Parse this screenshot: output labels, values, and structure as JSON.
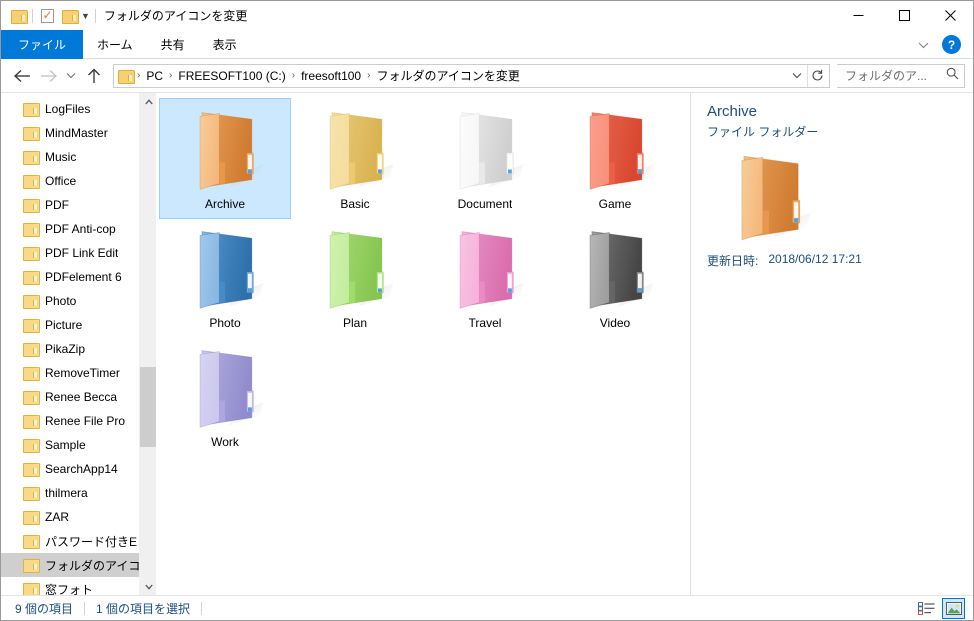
{
  "window": {
    "title": "フォルダのアイコンを変更",
    "quick_access": [
      "folder-icon",
      "properties-icon",
      "new-folder-icon",
      "dropdown-caret-icon"
    ],
    "controls": {
      "minimize": "─",
      "maximize": "□",
      "close": "✕"
    }
  },
  "ribbon": {
    "tabs": [
      {
        "label": "ファイル",
        "active_blue": true
      },
      {
        "label": "ホーム",
        "active_blue": false
      },
      {
        "label": "共有",
        "active_blue": false
      },
      {
        "label": "表示",
        "active_blue": false
      }
    ],
    "collapse_icon": "chevron-down-icon",
    "help_label": "?"
  },
  "nav": {
    "back_icon": "←",
    "forward_icon": "→",
    "recent_icon": "⌄",
    "up_icon": "↑",
    "breadcrumbs": [
      "PC",
      "FREESOFT100 (C:)",
      "freesoft100",
      "フォルダのアイコンを変更"
    ],
    "breadcrumb_separator": "›",
    "dropdown_icon": "⌄",
    "refresh_icon": "↻",
    "search": {
      "placeholder": "フォルダのア...",
      "value": "",
      "icon": "search-icon"
    }
  },
  "sidebar": {
    "items": [
      {
        "label": "LogFiles",
        "selected": false
      },
      {
        "label": "MindMaster",
        "selected": false
      },
      {
        "label": "Music",
        "selected": false
      },
      {
        "label": "Office",
        "selected": false
      },
      {
        "label": "PDF",
        "selected": false
      },
      {
        "label": "PDF Anti-cop",
        "selected": false
      },
      {
        "label": "PDF Link Edit",
        "selected": false
      },
      {
        "label": "PDFelement 6",
        "selected": false
      },
      {
        "label": "Photo",
        "selected": false
      },
      {
        "label": "Picture",
        "selected": false
      },
      {
        "label": "PikaZip",
        "selected": false
      },
      {
        "label": "RemoveTimer",
        "selected": false
      },
      {
        "label": "Renee Becca",
        "selected": false
      },
      {
        "label": "Renee File Pro",
        "selected": false
      },
      {
        "label": "Sample",
        "selected": false
      },
      {
        "label": "SearchApp14",
        "selected": false
      },
      {
        "label": "thilmera",
        "selected": false
      },
      {
        "label": "ZAR",
        "selected": false
      },
      {
        "label": "パスワード付きE",
        "selected": false
      },
      {
        "label": "フォルダのアイコ",
        "selected": true
      },
      {
        "label": "窓フォト",
        "selected": false
      }
    ],
    "scroll_up_icon": "⌃",
    "scroll_down_icon": "⌄"
  },
  "content": {
    "items": [
      {
        "label": "Archive",
        "selected": true,
        "colors": {
          "light": "#f7c383",
          "mid": "#ec9b4f",
          "dark": "#dd8335",
          "flap": "#f2a960",
          "edge": "#c97526"
        }
      },
      {
        "label": "Basic",
        "selected": false,
        "colors": {
          "light": "#f7dd9a",
          "mid": "#f0ce75",
          "dark": "#e6bd56",
          "flap": "#f4d68a",
          "edge": "#d8ab3e"
        }
      },
      {
        "label": "Document",
        "selected": false,
        "colors": {
          "light": "#fbfbfb",
          "mid": "#eeeeee",
          "dark": "#dcdcdc",
          "flap": "#f6f6f6",
          "edge": "#c9c9c9"
        }
      },
      {
        "label": "Game",
        "selected": false,
        "colors": {
          "light": "#fa8a73",
          "mid": "#f06149",
          "dark": "#e54c33",
          "flap": "#f77a60",
          "edge": "#cf3c24"
        }
      },
      {
        "label": "Photo",
        "selected": false,
        "colors": {
          "light": "#8dbde8",
          "mid": "#4a8fcc",
          "dark": "#3277b5",
          "flap": "#6fa9dd",
          "edge": "#2a639a"
        }
      },
      {
        "label": "Plan",
        "selected": false,
        "colors": {
          "light": "#c6ef9a",
          "mid": "#a4e070",
          "dark": "#8dd155",
          "flap": "#b8e98c",
          "edge": "#74b843"
        }
      },
      {
        "label": "Travel",
        "selected": false,
        "colors": {
          "light": "#f7b6dd",
          "mid": "#ef8ec9",
          "dark": "#e874b8",
          "flap": "#f3a4d3",
          "edge": "#d05ba0"
        }
      },
      {
        "label": "Video",
        "selected": false,
        "colors": {
          "light": "#a8a8a8",
          "mid": "#6a6a6a",
          "dark": "#4a4a4a",
          "flap": "#8a8a8a",
          "edge": "#3a3a3a"
        }
      },
      {
        "label": "Work",
        "selected": false,
        "colors": {
          "light": "#cdc9ef",
          "mid": "#b0abe4",
          "dark": "#9a94da",
          "flap": "#c2bdeb",
          "edge": "#827bc4"
        }
      }
    ]
  },
  "details": {
    "title": "Archive",
    "subtitle": "ファイル フォルダー",
    "icon_colors": {
      "light": "#f7c383",
      "mid": "#ec9b4f",
      "dark": "#dd8335",
      "flap": "#f2a960",
      "edge": "#c97526"
    },
    "rows": [
      {
        "key": "更新日時:",
        "value": "2018/06/12 17:21"
      }
    ]
  },
  "statusbar": {
    "item_count": "9 個の項目",
    "selection": "1 個の項目を選択",
    "views": [
      {
        "name": "details-view-button",
        "active": false
      },
      {
        "name": "large-icons-view-button",
        "active": true
      }
    ]
  },
  "colors": {
    "accent": "#0078d7",
    "selection_fill": "#cce8ff",
    "selection_border": "#99d1ff",
    "text_blue": "#1b4f7d"
  }
}
